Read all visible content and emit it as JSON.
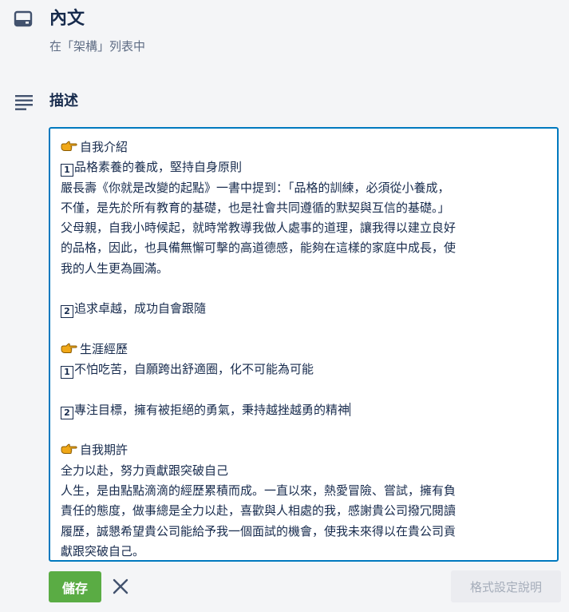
{
  "card": {
    "title": "內文",
    "subtitle": "在「架構」列表中"
  },
  "description": {
    "title": "描述",
    "lines": [
      {
        "kind": "hand",
        "text": "自我介紹"
      },
      {
        "kind": "box",
        "num": "1",
        "text": "品格素養的養成，堅持自身原則"
      },
      {
        "kind": "text",
        "text": "嚴長壽《你就是改變的起點》一書中提到：「品格的訓練，必須從小養成，"
      },
      {
        "kind": "text",
        "text": "不僅，是先於所有教育的基礎，也是社會共同遵循的默契與互信的基礎。」"
      },
      {
        "kind": "text",
        "text": "父母親，自我小時候起，就時常教導我做人處事的道理，讓我得以建立良好"
      },
      {
        "kind": "text",
        "text": "的品格，因此，也具備無懈可擊的高道德感，能夠在這樣的家庭中成長，使"
      },
      {
        "kind": "text",
        "text": "我的人生更為圓滿。"
      },
      {
        "kind": "blank"
      },
      {
        "kind": "box",
        "num": "2",
        "text": "追求卓越，成功自會跟隨"
      },
      {
        "kind": "blank"
      },
      {
        "kind": "hand",
        "text": "生涯經歷"
      },
      {
        "kind": "box",
        "num": "1",
        "text": "不怕吃苦，自願跨出舒適圈，化不可能為可能"
      },
      {
        "kind": "blank"
      },
      {
        "kind": "box",
        "num": "2",
        "text": "專注目標，擁有被拒絕的勇氣，秉持越挫越勇的精神",
        "caret": true
      },
      {
        "kind": "blank"
      },
      {
        "kind": "hand",
        "text": "自我期許"
      },
      {
        "kind": "text",
        "text": "全力以赴，努力貢獻跟突破自己"
      },
      {
        "kind": "text",
        "text": "人生，是由點點滴滴的經歷累積而成。一直以來，熱愛冒險、嘗試，擁有負"
      },
      {
        "kind": "text",
        "text": "責任的態度，做事總是全力以赴，喜歡與人相處的我，感謝貴公司撥冗閱讀"
      },
      {
        "kind": "text",
        "text": "履歷，誠懇希望貴公司能給予我一個面試的機會，使我未來得以在貴公司貢"
      },
      {
        "kind": "text",
        "text": "獻跟突破自己。"
      }
    ]
  },
  "actions": {
    "save_label": "儲存",
    "help_label": "格式設定說明"
  },
  "icons": {
    "card": "card-icon",
    "description": "description-lines-icon",
    "hand": "backhand-index-pointing-right-icon",
    "close": "close-icon"
  },
  "colors": {
    "accent": "#0079bf",
    "save": "#5aac44",
    "hand": "#f0a818"
  }
}
